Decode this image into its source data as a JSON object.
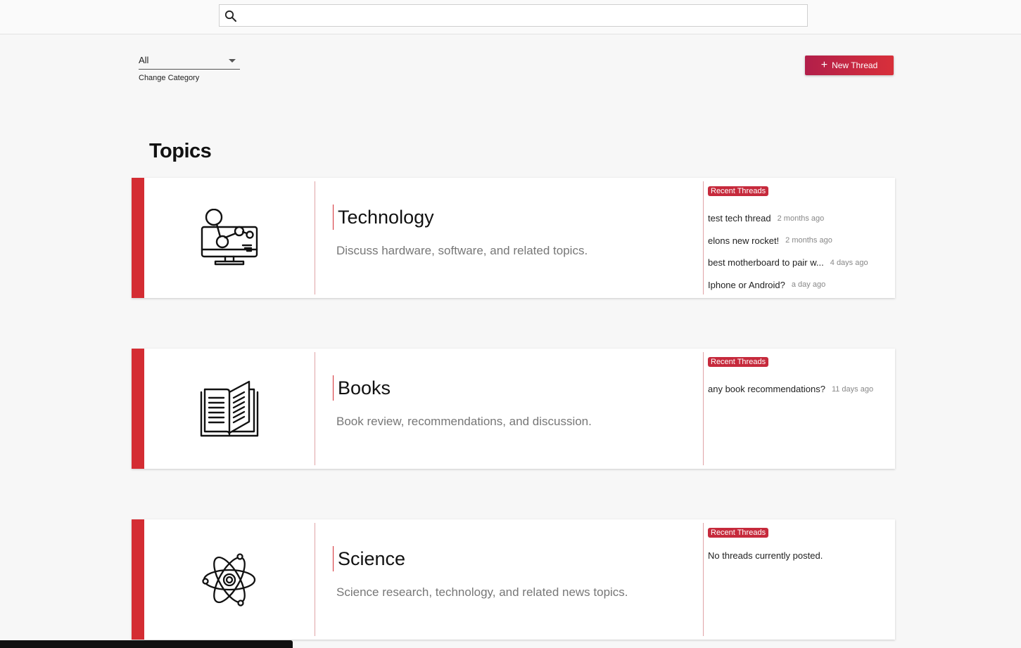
{
  "search": {
    "placeholder": "",
    "value": ""
  },
  "category": {
    "value": "All",
    "helper": "Change Category"
  },
  "new_thread_button": {
    "label": "New Thread",
    "icon": "plus-icon"
  },
  "topics_title": "Topics",
  "accent_color": "#d42d33",
  "badge_color": "#c62a3c",
  "topics": [
    {
      "title": "Technology",
      "description": "Discuss hardware, software, and related topics.",
      "icon": "computer-network-icon",
      "recent_label": "Recent Threads",
      "threads": [
        {
          "title": "test tech thread",
          "time": "2 months ago"
        },
        {
          "title": "elons new rocket!",
          "time": "2 months ago"
        },
        {
          "title": "best motherboard to pair w...",
          "time": "4 days ago"
        },
        {
          "title": "Iphone or Android?",
          "time": "a day ago"
        }
      ]
    },
    {
      "title": "Books",
      "description": "Book review, recommendations, and discussion.",
      "icon": "open-book-icon",
      "recent_label": "Recent Threads",
      "threads": [
        {
          "title": "any book recommendations?",
          "time": "11 days ago"
        }
      ]
    },
    {
      "title": "Science",
      "description": "Science research, technology, and related news topics.",
      "icon": "atom-icon",
      "recent_label": "Recent Threads",
      "empty_text": "No threads currently posted."
    }
  ]
}
